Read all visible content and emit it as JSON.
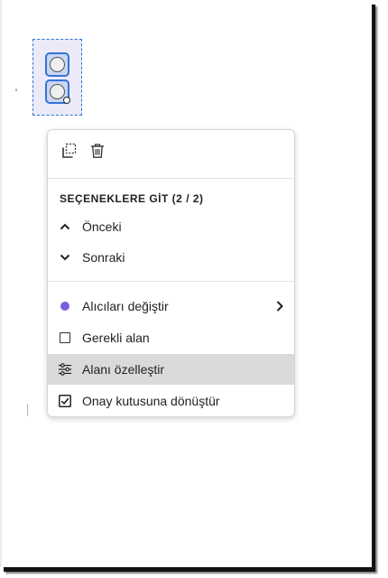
{
  "form_fields": {
    "radio_group_options": 2
  },
  "context_menu": {
    "toolbar": {
      "duplicate_icon": "duplicate-icon",
      "delete_icon": "trash-icon"
    },
    "navigation": {
      "title": "SEÇENEKLERE GİT (2 / 2)",
      "previous": "Önceki",
      "next": "Sonraki"
    },
    "actions": {
      "change_recipients": "Alıcıları değiştir",
      "recipient_color": "#7b5ce6",
      "required_field": "Gerekli alan",
      "customize_field": "Alanı özelleştir",
      "convert_to_checkbox": "Onay kutusuna dönüştür"
    },
    "highlighted_item": "Alanı özelleştir"
  }
}
